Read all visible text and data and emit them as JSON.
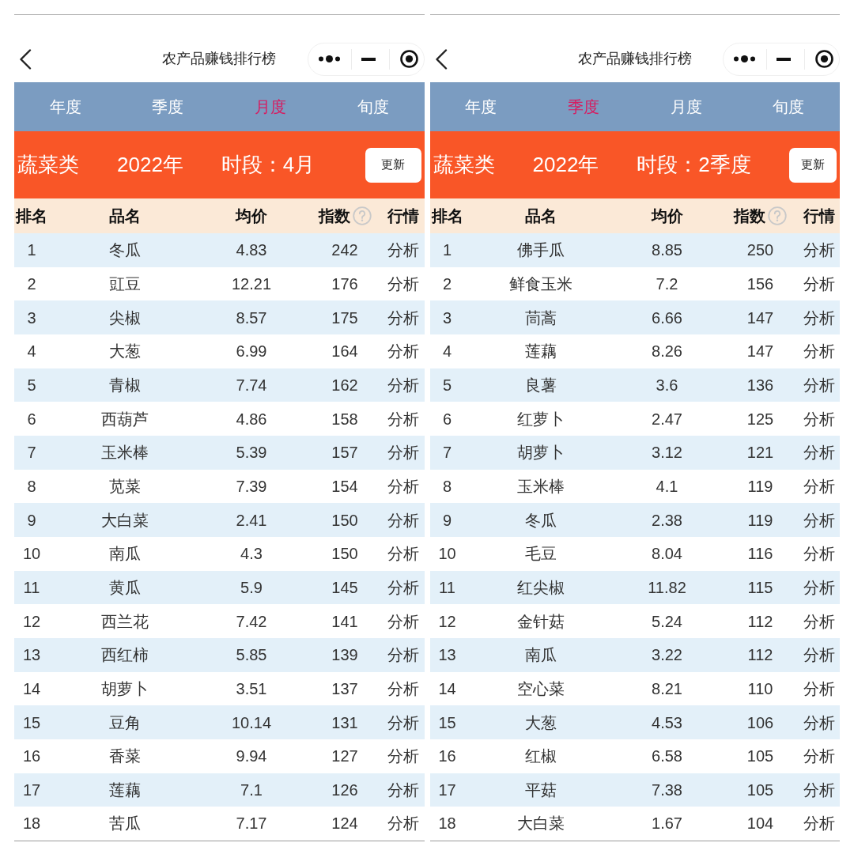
{
  "panels": [
    {
      "title_bar": {
        "title": "农产品赚钱排行榜"
      },
      "tabs": [
        {
          "label": "年度",
          "selected": false
        },
        {
          "label": "季度",
          "selected": false
        },
        {
          "label": "月度",
          "selected": true
        },
        {
          "label": "旬度",
          "selected": false
        }
      ],
      "filter_bar": {
        "category": "蔬菜类",
        "year": "2022年",
        "period": "时段：4月",
        "button": "更新"
      },
      "table": {
        "columns": [
          {
            "label": "排名",
            "help_icon": false
          },
          {
            "label": "品名",
            "help_icon": false
          },
          {
            "label": "均价",
            "help_icon": false
          },
          {
            "label": "指数",
            "help_icon": true
          },
          {
            "label": "行情",
            "help_icon": false
          }
        ],
        "rows": [
          [
            "1",
            "冬瓜",
            "4.83",
            "242",
            "分析"
          ],
          [
            "2",
            "豇豆",
            "12.21",
            "176",
            "分析"
          ],
          [
            "3",
            "尖椒",
            "8.57",
            "175",
            "分析"
          ],
          [
            "4",
            "大葱",
            "6.99",
            "164",
            "分析"
          ],
          [
            "5",
            "青椒",
            "7.74",
            "162",
            "分析"
          ],
          [
            "6",
            "西葫芦",
            "4.86",
            "158",
            "分析"
          ],
          [
            "7",
            "玉米棒",
            "5.39",
            "157",
            "分析"
          ],
          [
            "8",
            "苋菜",
            "7.39",
            "154",
            "分析"
          ],
          [
            "9",
            "大白菜",
            "2.41",
            "150",
            "分析"
          ],
          [
            "10",
            "南瓜",
            "4.3",
            "150",
            "分析"
          ],
          [
            "11",
            "黄瓜",
            "5.9",
            "145",
            "分析"
          ],
          [
            "12",
            "西兰花",
            "7.42",
            "141",
            "分析"
          ],
          [
            "13",
            "西红柿",
            "5.85",
            "139",
            "分析"
          ],
          [
            "14",
            "胡萝卜",
            "3.51",
            "137",
            "分析"
          ],
          [
            "15",
            "豆角",
            "10.14",
            "131",
            "分析"
          ],
          [
            "16",
            "香菜",
            "9.94",
            "127",
            "分析"
          ],
          [
            "17",
            "莲藕",
            "7.1",
            "126",
            "分析"
          ],
          [
            "18",
            "苦瓜",
            "7.17",
            "124",
            "分析"
          ]
        ]
      }
    },
    {
      "title_bar": {
        "title": "农产品赚钱排行榜"
      },
      "tabs": [
        {
          "label": "年度",
          "selected": false
        },
        {
          "label": "季度",
          "selected": true
        },
        {
          "label": "月度",
          "selected": false
        },
        {
          "label": "旬度",
          "selected": false
        }
      ],
      "filter_bar": {
        "category": "蔬菜类",
        "year": "2022年",
        "period": "时段：2季度",
        "button": "更新"
      },
      "table": {
        "columns": [
          {
            "label": "排名",
            "help_icon": false
          },
          {
            "label": "品名",
            "help_icon": false
          },
          {
            "label": "均价",
            "help_icon": false
          },
          {
            "label": "指数",
            "help_icon": true
          },
          {
            "label": "行情",
            "help_icon": false
          }
        ],
        "rows": [
          [
            "1",
            "佛手瓜",
            "8.85",
            "250",
            "分析"
          ],
          [
            "2",
            "鲜食玉米",
            "7.2",
            "156",
            "分析"
          ],
          [
            "3",
            "茼蒿",
            "6.66",
            "147",
            "分析"
          ],
          [
            "4",
            "莲藕",
            "8.26",
            "147",
            "分析"
          ],
          [
            "5",
            "良薯",
            "3.6",
            "136",
            "分析"
          ],
          [
            "6",
            "红萝卜",
            "2.47",
            "125",
            "分析"
          ],
          [
            "7",
            "胡萝卜",
            "3.12",
            "121",
            "分析"
          ],
          [
            "8",
            "玉米棒",
            "4.1",
            "119",
            "分析"
          ],
          [
            "9",
            "冬瓜",
            "2.38",
            "119",
            "分析"
          ],
          [
            "10",
            "毛豆",
            "8.04",
            "116",
            "分析"
          ],
          [
            "11",
            "红尖椒",
            "11.82",
            "115",
            "分析"
          ],
          [
            "12",
            "金针菇",
            "5.24",
            "112",
            "分析"
          ],
          [
            "13",
            "南瓜",
            "3.22",
            "112",
            "分析"
          ],
          [
            "14",
            "空心菜",
            "8.21",
            "110",
            "分析"
          ],
          [
            "15",
            "大葱",
            "4.53",
            "106",
            "分析"
          ],
          [
            "16",
            "红椒",
            "6.58",
            "105",
            "分析"
          ],
          [
            "17",
            "平菇",
            "7.38",
            "105",
            "分析"
          ],
          [
            "18",
            "大白菜",
            "1.67",
            "104",
            "分析"
          ]
        ]
      }
    }
  ]
}
